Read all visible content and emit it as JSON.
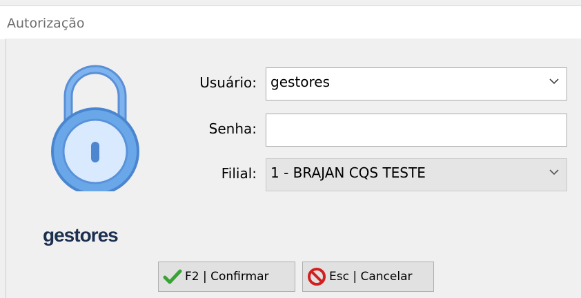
{
  "window": {
    "title": "Autorização"
  },
  "lock": {
    "icon": "padlock-icon",
    "label": "gestores",
    "color": "#6aa7e8"
  },
  "form": {
    "user": {
      "label": "Usuário:",
      "value": "gestores"
    },
    "password": {
      "label": "Senha:",
      "value": ""
    },
    "branch": {
      "label": "Filial:",
      "value": "1 - BRAJAN CQS TESTE"
    }
  },
  "buttons": {
    "confirm": {
      "label": "F2 | Confirmar",
      "icon": "checkmark-icon",
      "color": "#3aa335"
    },
    "cancel": {
      "label": "Esc | Cancelar",
      "icon": "prohibited-icon",
      "color": "#d21f1f"
    }
  }
}
